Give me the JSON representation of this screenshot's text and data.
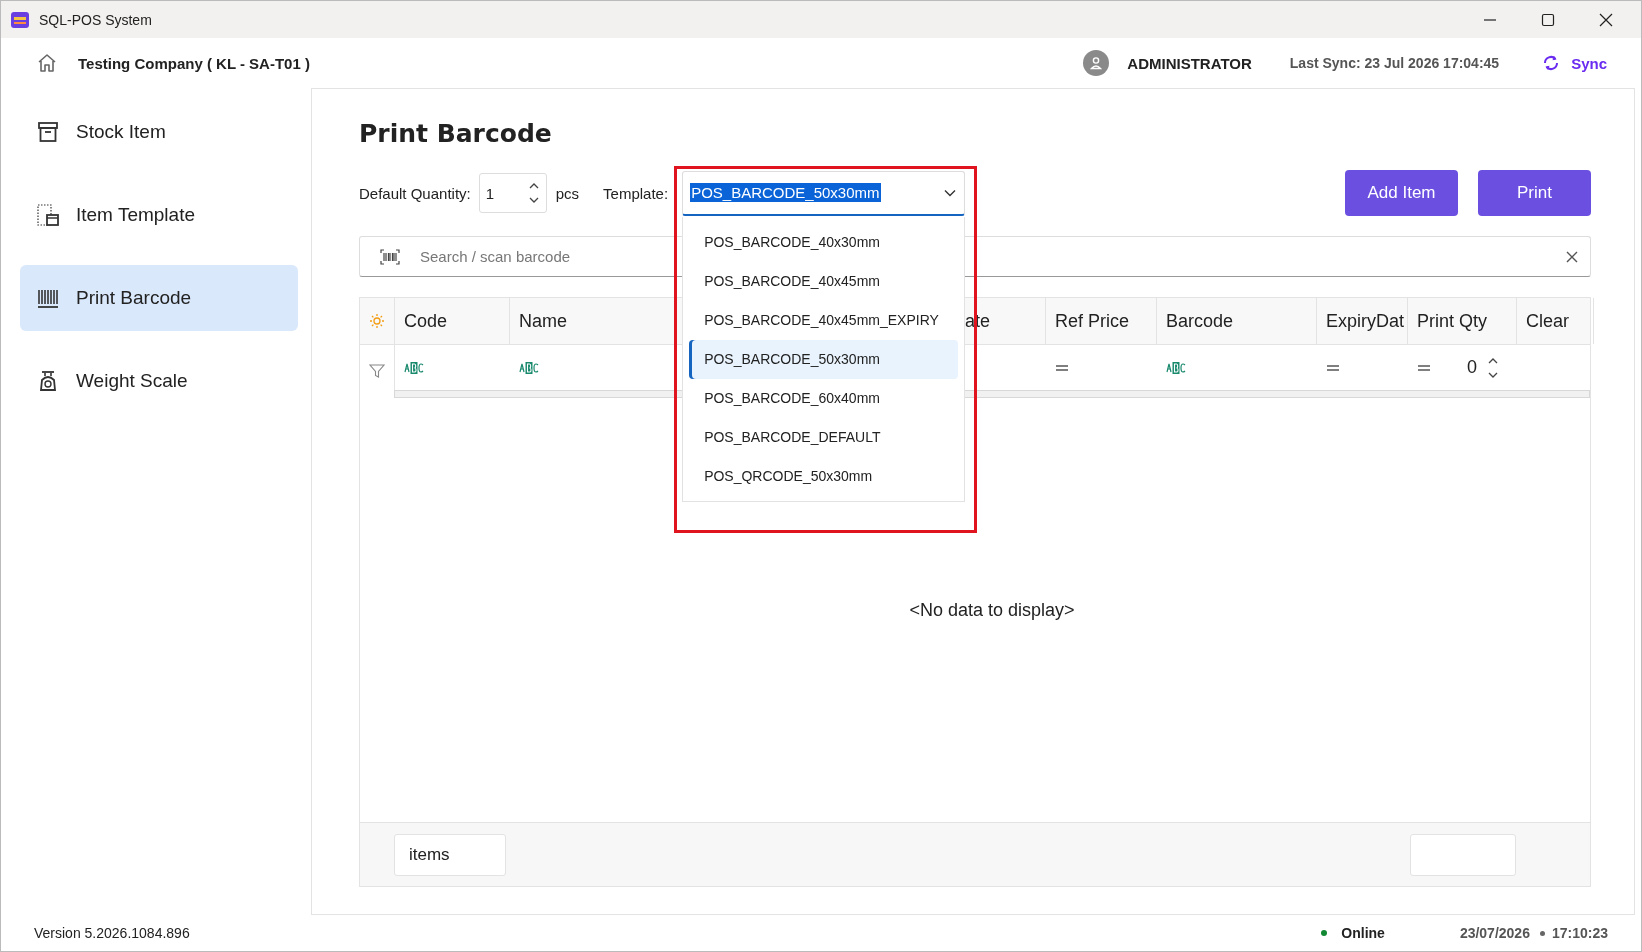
{
  "window": {
    "title": "SQL-POS System"
  },
  "header": {
    "company": "Testing Company ( KL - SA-T01 )",
    "user": "ADMINISTRATOR",
    "last_sync": "Last Sync: 23 Jul 2026 17:04:45",
    "sync_button": "Sync"
  },
  "sidebar": {
    "items": [
      {
        "label": "Stock Item",
        "kind": "archive",
        "selected": false
      },
      {
        "label": "Item Template",
        "kind": "template",
        "selected": false
      },
      {
        "label": "Print Barcode",
        "kind": "barcode",
        "selected": true
      },
      {
        "label": "Weight Scale",
        "kind": "scale",
        "selected": false
      }
    ]
  },
  "page": {
    "title": "Print Barcode",
    "default_quantity": {
      "label": "Default Quantity:",
      "value": "1",
      "unit": "pcs"
    },
    "template": {
      "label": "Template:",
      "value": "POS_BARCODE_50x30mm",
      "expanded": true,
      "highlighted": true,
      "options": [
        {
          "label": "POS_BARCODE_40x30mm",
          "selected": false
        },
        {
          "label": "POS_BARCODE_40x45mm",
          "selected": false
        },
        {
          "label": "POS_BARCODE_40x45mm_EXPIRY",
          "selected": false
        },
        {
          "label": "POS_BARCODE_50x30mm",
          "selected": true
        },
        {
          "label": "POS_BARCODE_60x40mm",
          "selected": false
        },
        {
          "label": "POS_BARCODE_DEFAULT",
          "selected": false
        },
        {
          "label": "POS_QRCODE_50x30mm",
          "selected": false
        }
      ]
    },
    "buttons": [
      "Add Item",
      "Print"
    ],
    "search": {
      "placeholder": "Search / scan barcode"
    }
  },
  "table": {
    "columns": [
      {
        "label": "Code",
        "filter": {
          "kind": "text"
        }
      },
      {
        "label": "Name",
        "filter": {
          "kind": "text"
        }
      },
      {
        "label": "ate"
      },
      {
        "label": "Ref Price",
        "filter": {
          "kind": "number"
        }
      },
      {
        "label": "Barcode",
        "filter": {
          "kind": "text"
        }
      },
      {
        "label": "ExpiryDat",
        "filter": {
          "kind": "number"
        }
      },
      {
        "label": "Print Qty",
        "filter": {
          "kind": "number",
          "value": "0"
        }
      },
      {
        "label": "Clear"
      }
    ],
    "empty_message": "<No data to display>",
    "footer": {
      "count_label": "items"
    }
  },
  "status_bar": {
    "version": "Version 5.2026.1084.896",
    "connection": "Online",
    "online": true,
    "date": "23/07/2026",
    "time": "17:10:23"
  }
}
